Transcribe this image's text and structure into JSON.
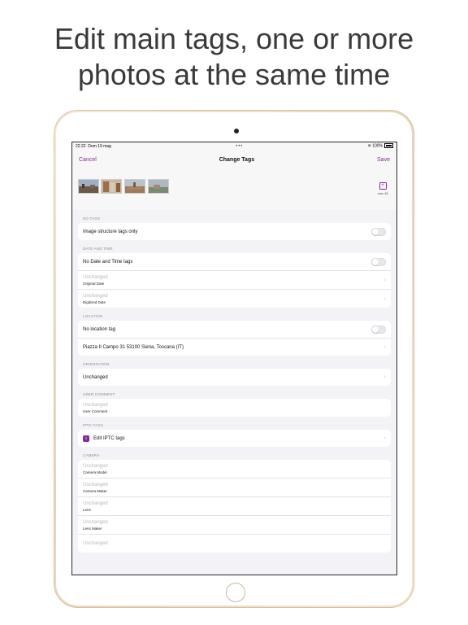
{
  "headline": {
    "line1": "Edit main tags, one or more",
    "line2": "photos at the same time"
  },
  "status": {
    "time": "22:22",
    "date": "Dom 19 mag",
    "dots": "•••",
    "wifi": "wifi-icon",
    "battery": "100%"
  },
  "nav": {
    "cancel": "Cancel",
    "title": "Change Tags",
    "save": "Save"
  },
  "photos": {
    "max_label": "max 48",
    "add_icon": "add-photo-icon"
  },
  "sections": {
    "no_tags": {
      "header": "NO TAGS",
      "row": "Image structure tags only"
    },
    "date_time": {
      "header": "DATE AND TIME",
      "toggle_row": "No Date and Time tags",
      "original": {
        "value": "Unchanged",
        "label": "Original Date"
      },
      "digitized": {
        "value": "Unchanged",
        "label": "Digitized Date"
      }
    },
    "location": {
      "header": "LOCATION",
      "toggle_row": "No location tag",
      "address": "Piazza Il Campo 31 53100 Siena, Toscana (IT)"
    },
    "orientation": {
      "header": "ORIENTATION",
      "value": "Unchanged"
    },
    "user_comment": {
      "header": "USER COMMENT",
      "value": "Unchanged",
      "label": "User Comment"
    },
    "iptc": {
      "header": "IPTC TAGS",
      "row": "Edit IPTC tags"
    },
    "camera": {
      "header": "CAMERA",
      "model": {
        "value": "Unchanged",
        "label": "Camera Model"
      },
      "maker": {
        "value": "Unchanged",
        "label": "Camera Maker"
      },
      "lens": {
        "value": "Unchanged",
        "label": "Lens"
      },
      "lens_maker": {
        "value": "Unchanged",
        "label": "Lens Maker"
      },
      "next": {
        "value": "Unchanged"
      }
    }
  },
  "colors": {
    "accent": "#8a2a9a",
    "background": "#f2f2f7"
  }
}
